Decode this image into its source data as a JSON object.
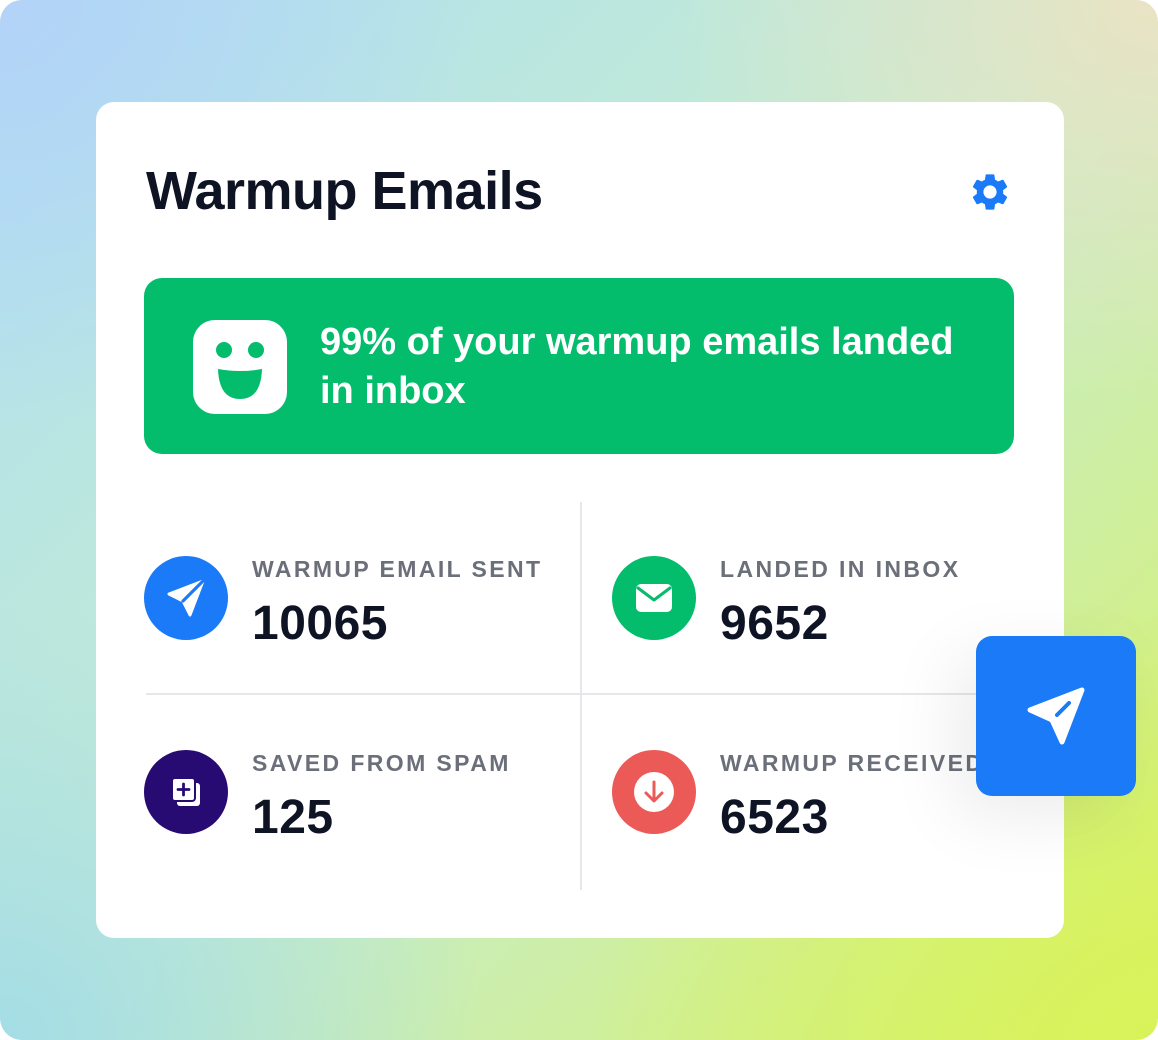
{
  "widget": {
    "title": "Warmup Emails",
    "settings_icon": "gear-icon",
    "accent_color": "#1a7af8"
  },
  "banner": {
    "icon": "smiley-face-icon",
    "message": "99% of your warmup emails landed in inbox",
    "color": "#03bd6c"
  },
  "stats": [
    {
      "label": "WARMUP EMAIL SENT",
      "value": "10065",
      "icon": "paper-plane-icon",
      "color": "#1a7af8"
    },
    {
      "label": "LANDED IN INBOX",
      "value": "9652",
      "icon": "envelope-icon",
      "color": "#03bd6c"
    },
    {
      "label": "SAVED FROM SPAM",
      "value": "125",
      "icon": "add-copy-icon",
      "color": "#280a73"
    },
    {
      "label": "WARMUP RECEIVED",
      "value": "6523",
      "icon": "download-arrow-icon",
      "color": "#ec5a58"
    }
  ],
  "floating_badge": {
    "icon": "send-icon",
    "color": "#1a7af8"
  }
}
